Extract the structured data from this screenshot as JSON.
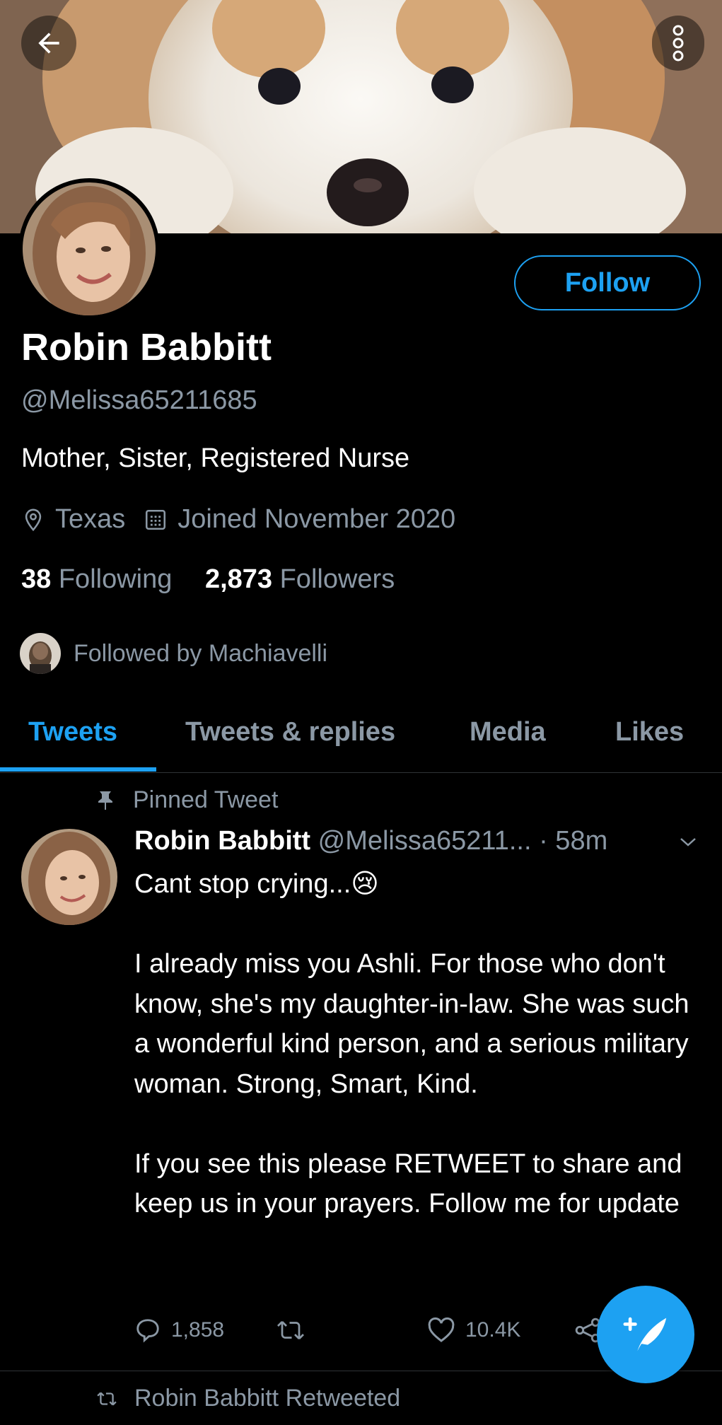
{
  "header": {
    "back_icon": "arrow-left-icon",
    "more_icon": "more-vertical-icon"
  },
  "profile": {
    "name": "Robin Babbitt",
    "handle": "@Melissa65211685",
    "bio": "Mother, Sister, Registered Nurse",
    "location": "Texas",
    "joined": "Joined November 2020",
    "following_count": "38",
    "following_label": "Following",
    "followers_count": "2,873",
    "followers_label": "Followers",
    "followed_by": "Followed by Machiavelli",
    "follow_button": "Follow"
  },
  "tabs": [
    {
      "label": "Tweets",
      "active": true
    },
    {
      "label": "Tweets & replies",
      "active": false
    },
    {
      "label": "Media",
      "active": false
    },
    {
      "label": "Likes",
      "active": false
    }
  ],
  "tweet": {
    "pinned_label": "Pinned Tweet",
    "author_name": "Robin Babbitt",
    "author_handle": "@Melissa65211...",
    "time": "· 58m",
    "line1": "Cant stop crying...",
    "emoji": "😢",
    "paragraph2": "I already miss you Ashli. For those who don't know, she's my daughter-in-law. She was such a wonderful kind person, and a serious military woman. Strong, Smart, Kind.",
    "paragraph3": "If you see this please RETWEET to share and keep us in your prayers. Follow me for update",
    "replies": "1,858",
    "retweets": "",
    "likes": "10.4K"
  },
  "next_item": {
    "retweeted_label": "Robin Babbitt Retweeted"
  },
  "colors": {
    "accent": "#1da1f2",
    "muted": "#8b98a5",
    "background": "#000000"
  }
}
